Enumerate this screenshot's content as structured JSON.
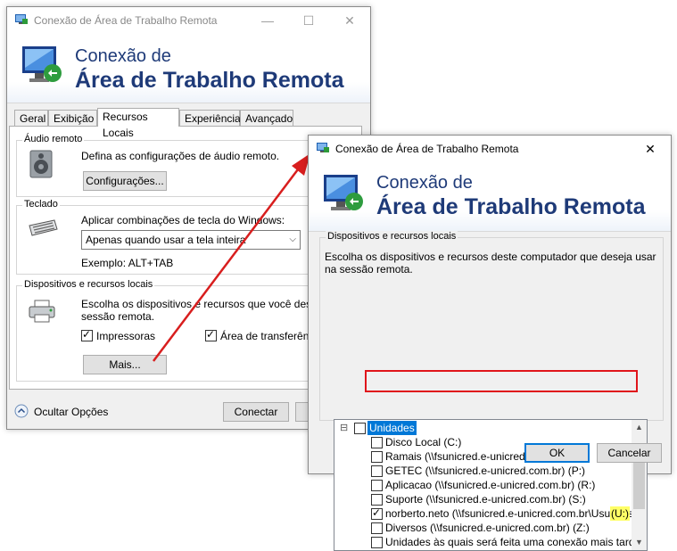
{
  "back_window": {
    "title": "Conexão de Área de Trabalho Remota",
    "banner_line1": "Conexão de",
    "banner_line2": "Área de Trabalho Remota",
    "tabs": [
      "Geral",
      "Exibição",
      "Recursos Locais",
      "Experiência",
      "Avançado"
    ],
    "audio": {
      "group": "Áudio remoto",
      "desc": "Defina as configurações de áudio remoto.",
      "button": "Configurações..."
    },
    "keyboard": {
      "group": "Teclado",
      "desc": "Aplicar combinações de tecla do Windows:",
      "selected": "Apenas quando usar a tela inteira",
      "example": "Exemplo: ALT+TAB"
    },
    "devices": {
      "group": "Dispositivos e recursos locais",
      "desc_line1": "Escolha os dispositivos e recursos que você deseja u",
      "desc_line2": "sessão remota.",
      "printers": "Impressoras",
      "clipboard": "Área de transferência",
      "more_button": "Mais..."
    },
    "hide_options": "Ocultar Opções",
    "connect_button": "Conectar"
  },
  "front_window": {
    "title": "Conexão de Área de Trabalho Remota",
    "banner_line1": "Conexão de",
    "banner_line2": "Área de Trabalho Remota",
    "group": "Dispositivos e recursos locais",
    "desc_line1": "Escolha os dispositivos e recursos deste computador que deseja usar",
    "desc_line2": "na sessão remota.",
    "tree": {
      "expander": "⊟",
      "root": "Unidades",
      "items": [
        {
          "label": "Disco Local (C:)",
          "checked": false
        },
        {
          "label": "Ramais (\\\\fsunicred.e-unicred.com.br) (I:)",
          "checked": false
        },
        {
          "label": "GETEC (\\\\fsunicred.e-unicred.com.br) (P:)",
          "checked": false
        },
        {
          "label": "Aplicacao (\\\\fsunicred.e-unicred.com.br) (R:)",
          "checked": false
        },
        {
          "label": "Suporte (\\\\fsunicred.e-unicred.com.br) (S:)",
          "checked": false
        },
        {
          "label": "norberto.neto (\\\\fsunicred.e-unicred.com.br\\Usuarios)",
          "suffix": "(U:)",
          "checked": true
        },
        {
          "label": "Diversos (\\\\fsunicred.e-unicred.com.br) (Z:)",
          "checked": false
        },
        {
          "label": "Unidades às quais será feita uma conexão mais tarde",
          "checked": false
        }
      ]
    },
    "ok_button": "OK",
    "cancel_button": "Cancelar"
  },
  "colors": {
    "highlight": "#e0151b",
    "arrow": "#d81e1e",
    "banner_text": "#1e3a78"
  }
}
